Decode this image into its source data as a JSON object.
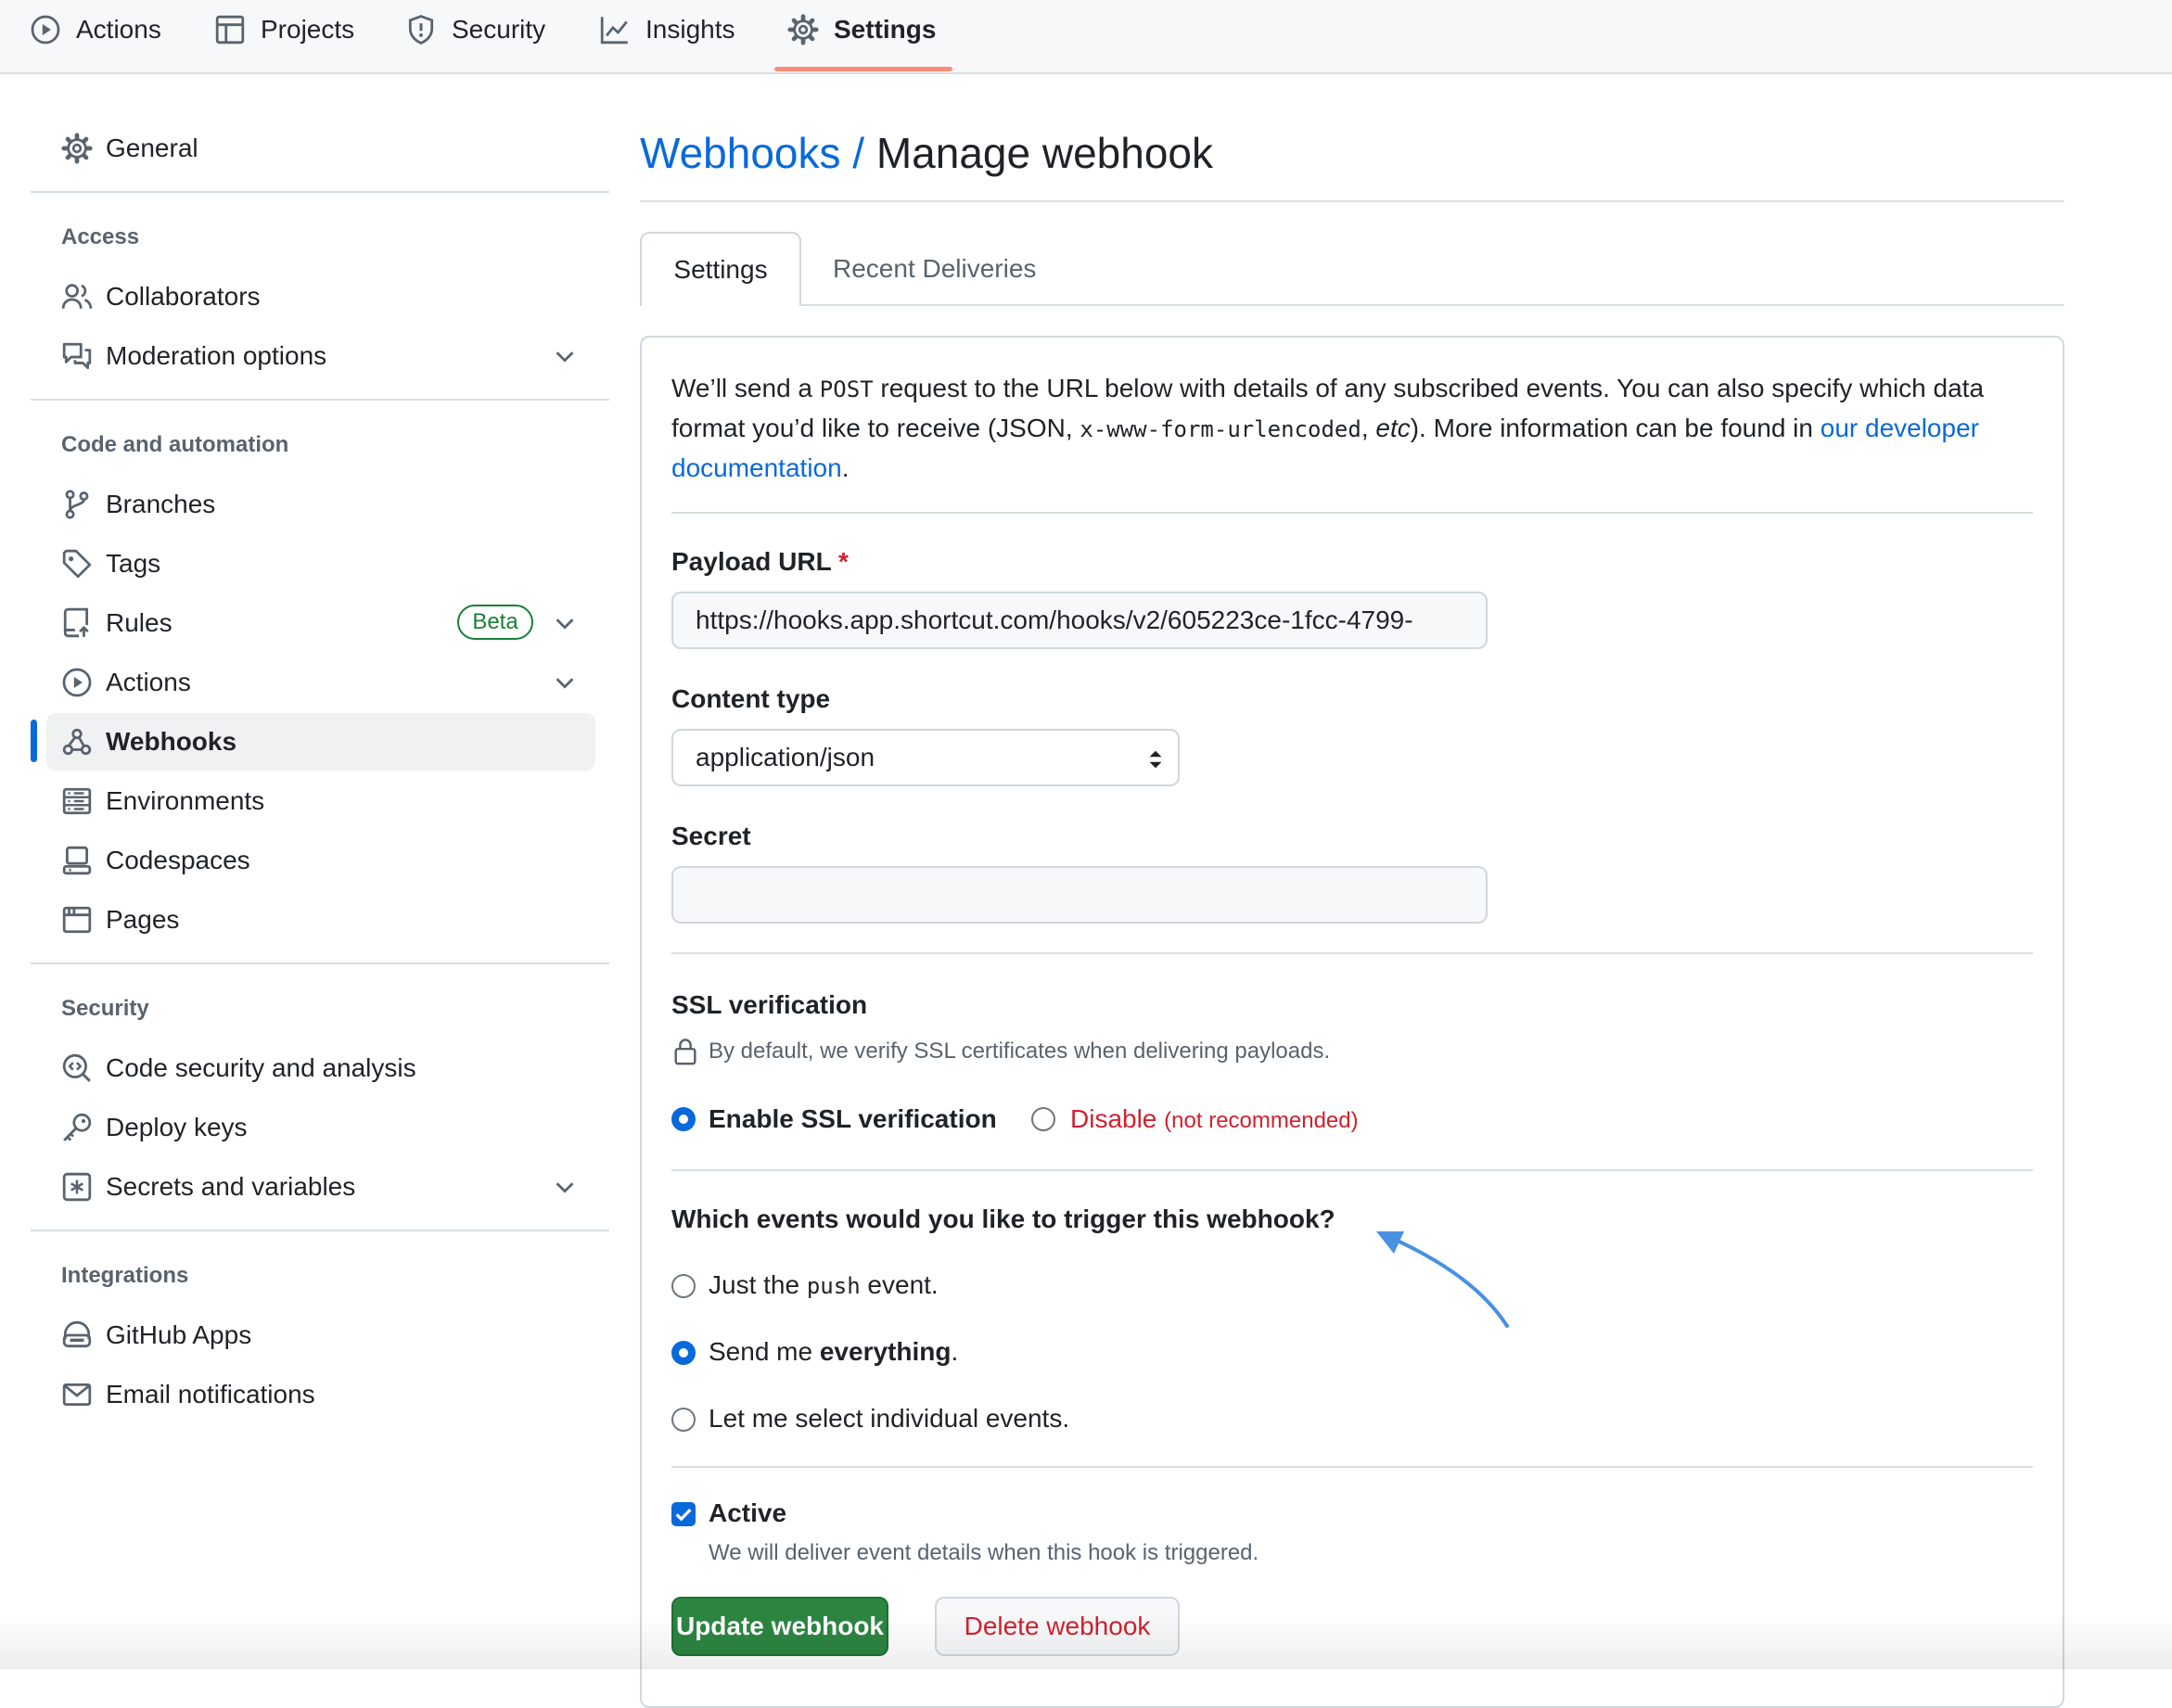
{
  "topnav": {
    "items": [
      {
        "label": "Actions",
        "icon": "play-circle-icon"
      },
      {
        "label": "Projects",
        "icon": "table-icon"
      },
      {
        "label": "Security",
        "icon": "shield-icon"
      },
      {
        "label": "Insights",
        "icon": "graph-icon"
      },
      {
        "label": "Settings",
        "icon": "gear-icon",
        "active": true
      }
    ]
  },
  "sidebar": {
    "general": "General",
    "access": {
      "heading": "Access",
      "collaborators": "Collaborators",
      "moderation": "Moderation options"
    },
    "code": {
      "heading": "Code and automation",
      "branches": "Branches",
      "tags": "Tags",
      "rules": "Rules",
      "rules_badge": "Beta",
      "actions": "Actions",
      "webhooks": "Webhooks",
      "environments": "Environments",
      "codespaces": "Codespaces",
      "pages": "Pages"
    },
    "security": {
      "heading": "Security",
      "code_security": "Code security and analysis",
      "deploy_keys": "Deploy keys",
      "secrets": "Secrets and variables"
    },
    "integrations": {
      "heading": "Integrations",
      "github_apps": "GitHub Apps",
      "email": "Email notifications"
    }
  },
  "header": {
    "breadcrumb_link": "Webhooks",
    "separator": "/",
    "title": "Manage webhook"
  },
  "tabs": {
    "settings": "Settings",
    "deliveries": "Recent Deliveries"
  },
  "intro": {
    "t1": "We’ll send a ",
    "post": "POST",
    "t2": " request to the URL below with details of any subscribed events. You can also specify which data format you’d like to receive (JSON, ",
    "form": "x-www-form-urlencoded",
    "t3": ", ",
    "etc": "etc",
    "t4": "). More information can be found in ",
    "link": "our developer documentation",
    "t5": "."
  },
  "form": {
    "payload_label": "Payload URL",
    "required_mark": "*",
    "payload_value": "https://hooks.app.shortcut.com/hooks/v2/605223ce-1fcc-4799-",
    "content_type_label": "Content type",
    "content_type_value": "application/json",
    "secret_label": "Secret",
    "secret_value": ""
  },
  "ssl": {
    "heading": "SSL verification",
    "note": "By default, we verify SSL certificates when delivering payloads.",
    "enable": "Enable SSL verification",
    "enable_selected": true,
    "disable": "Disable",
    "disable_note": "(not recommended)"
  },
  "events": {
    "question": "Which events would you like to trigger this webhook?",
    "push_a": "Just the ",
    "push_code": "push",
    "push_b": " event.",
    "everything_a": "Send me ",
    "everything_b": "everything",
    "everything_c": ".",
    "individual": "Let me select individual events.",
    "selected": "everything"
  },
  "active": {
    "label": "Active",
    "checked": true,
    "note": "We will deliver event details when this hook is triggered."
  },
  "buttons": {
    "update": "Update webhook",
    "delete": "Delete webhook"
  },
  "colors": {
    "link": "#0969da",
    "danger": "#cf222e",
    "primary_button": "#2c8541",
    "nav_underline": "#fd8c73",
    "annotation_arrow": "#4a90e2"
  }
}
